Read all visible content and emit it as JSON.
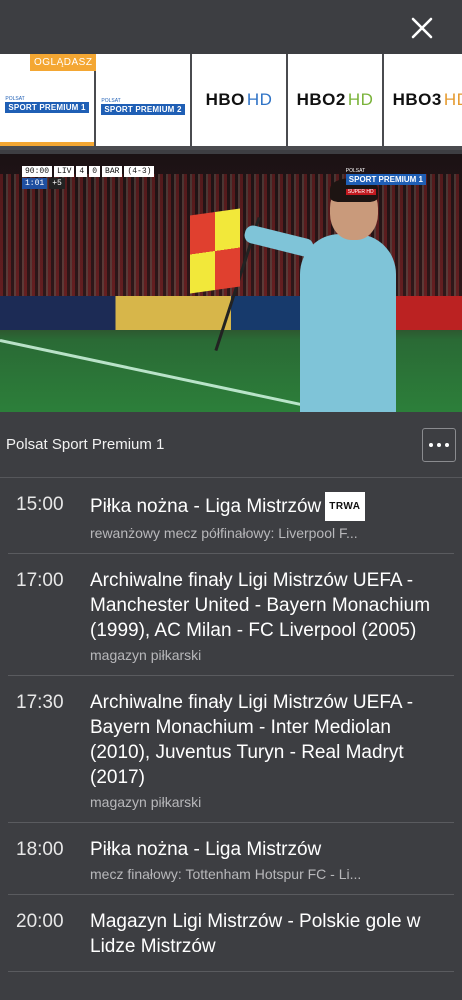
{
  "channels": [
    {
      "id": "psp1",
      "badge": "OGLĄDASZ",
      "logo_small": "POLSAT",
      "logo_main": "SPORT PREMIUM 1",
      "active": true
    },
    {
      "id": "psp2",
      "logo_small": "POLSAT",
      "logo_main": "SPORT PREMIUM 2"
    },
    {
      "id": "hbo",
      "logo_main": "HBO",
      "logo_hd": "HD"
    },
    {
      "id": "hbo2",
      "logo_main": "HBO2",
      "logo_hd": "HD"
    },
    {
      "id": "hbo3",
      "logo_main": "HBO3",
      "logo_hd": "HD"
    }
  ],
  "player": {
    "scorebug": {
      "clock": "90:00",
      "home": "LIV",
      "home_score": "4",
      "away_score": "0",
      "away": "BAR",
      "agg": "(4-3)",
      "added": "1:01",
      "plus": "+5"
    },
    "watermark": {
      "small": "POLSAT",
      "main": "SPORT PREMIUM 1",
      "sub": "SUPER HD"
    }
  },
  "current_channel": {
    "name": "Polsat Sport Premium 1"
  },
  "schedule": [
    {
      "time": "15:00",
      "title": "Piłka nożna - Liga Mistrzów",
      "live_badge": "TRWA",
      "subtitle": "rewanżowy mecz półfinałowy: Liverpool F..."
    },
    {
      "time": "17:00",
      "title": "Archiwalne finały Ligi Mistrzów UEFA - Manchester United - Bayern Monachium (1999), AC Milan - FC Liverpool (2005)",
      "subtitle": "magazyn piłkarski"
    },
    {
      "time": "17:30",
      "title": "Archiwalne finały Ligi Mistrzów UEFA - Bayern Monachium - Inter Mediolan (2010), Juventus Turyn - Real Madryt (2017)",
      "subtitle": "magazyn piłkarski"
    },
    {
      "time": "18:00",
      "title": "Piłka nożna - Liga Mistrzów",
      "subtitle": "mecz finałowy: Tottenham Hotspur FC - Li..."
    },
    {
      "time": "20:00",
      "title": "Magazyn Ligi Mistrzów - Polskie gole w Lidze Mistrzów",
      "subtitle": ""
    }
  ]
}
